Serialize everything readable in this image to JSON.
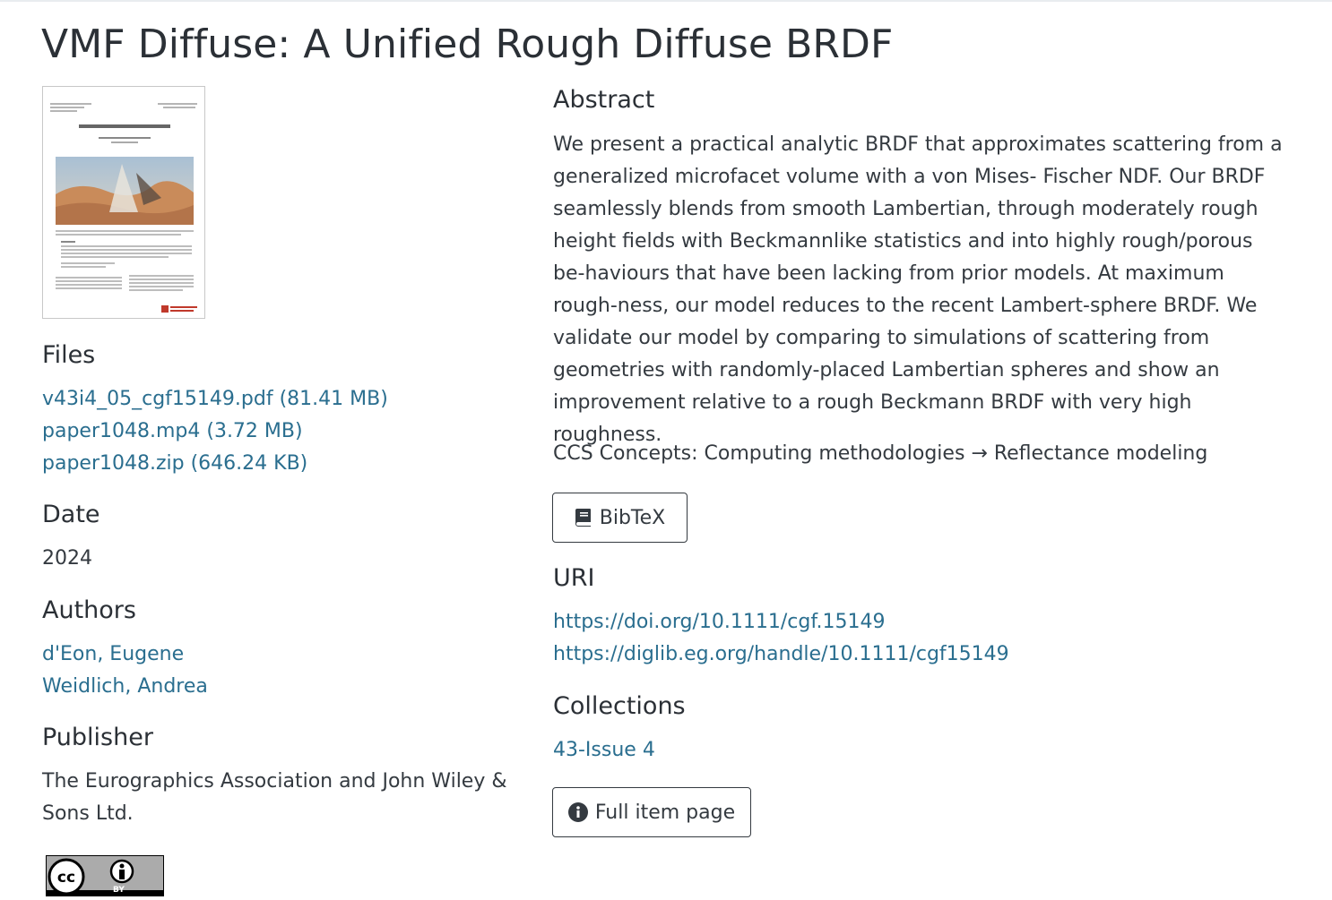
{
  "page": {
    "title": "VMF Diffuse: A Unified Rough Diffuse BRDF"
  },
  "thumbnail": {
    "alt_name": "paper-thumbnail"
  },
  "files": {
    "heading": "Files",
    "items": [
      "v43i4_05_cgf15149.pdf (81.41 MB)",
      "paper1048.mp4 (3.72 MB)",
      "paper1048.zip (646.24 KB)"
    ]
  },
  "date": {
    "heading": "Date",
    "value": "2024"
  },
  "authors": {
    "heading": "Authors",
    "items": [
      "d'Eon, Eugene",
      "Weidlich, Andrea"
    ]
  },
  "publisher": {
    "heading": "Publisher",
    "line1": "The Eurographics Association and John Wiley &",
    "line2": "Sons Ltd."
  },
  "license": {
    "icon": "cc-by-icon",
    "text": "BY"
  },
  "abstract": {
    "heading": "Abstract",
    "text": "We present a practical analytic BRDF that approximates scattering from a generalized microfacet volume with a von Mises- Fischer NDF. Our BRDF seamlessly blends from smooth Lambertian, through moderately rough height fields with Beckmannlike statistics and into highly rough/porous be-haviours that have been lacking from prior models. At maximum rough-ness, our model reduces to the recent Lambert-sphere BRDF. We validate our model by comparing to simulations of scattering from geometries with randomly-placed Lambertian spheres and show an improvement relative to a rough Beckmann BRDF with very high roughness.",
    "ccs": "CCS Concepts: Computing methodologies → Reflectance modeling"
  },
  "buttons": {
    "bibtex": "BibTeX",
    "full_item": "Full item page"
  },
  "uri": {
    "heading": "URI",
    "items": [
      "https://doi.org/10.1111/cgf.15149",
      "https://diglib.eg.org/handle/10.1111/cgf15149"
    ]
  },
  "collections": {
    "heading": "Collections",
    "items": [
      "43-Issue 4"
    ]
  }
}
